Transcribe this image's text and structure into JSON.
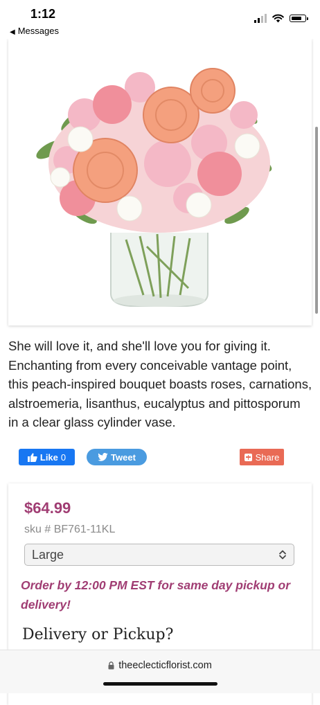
{
  "status_bar": {
    "time": "1:12",
    "back_label": "Messages",
    "signal_bars": 2,
    "signal_total": 4,
    "battery_level": 0.8
  },
  "product": {
    "image_alt": "Peach roses, carnations and alstroemeria bouquet in a clear glass cylinder vase",
    "description": "She will love it, and she'll love you for giving it. Enchanting from every conceivable vantage point, this peach-inspired bouquet boasts roses, carnations, alstroemeria, lisanthus, eucalyptus and pittosporum in a clear glass cylinder vase."
  },
  "social": {
    "like_label": "Like",
    "like_count": "0",
    "tweet_label": "Tweet",
    "share_label": "Share"
  },
  "purchase": {
    "price": "$64.99",
    "sku": "sku # BF761-11KL",
    "size_selected": "Large",
    "order_note": "Order by 12:00 PM EST for same day pickup or delivery!",
    "delivery_heading": "Delivery or Pickup?"
  },
  "browser": {
    "url": "theeclecticflorist.com"
  },
  "colors": {
    "accent": "#a03d73",
    "facebook": "#1877f2",
    "twitter": "#4a9be0",
    "share": "#e96a55"
  },
  "icons": [
    "chevron-left-icon",
    "signal-icon",
    "wifi-icon",
    "battery-icon",
    "thumbs-up-icon",
    "twitter-bird-icon",
    "plus-icon",
    "select-arrows-icon",
    "lock-icon"
  ]
}
